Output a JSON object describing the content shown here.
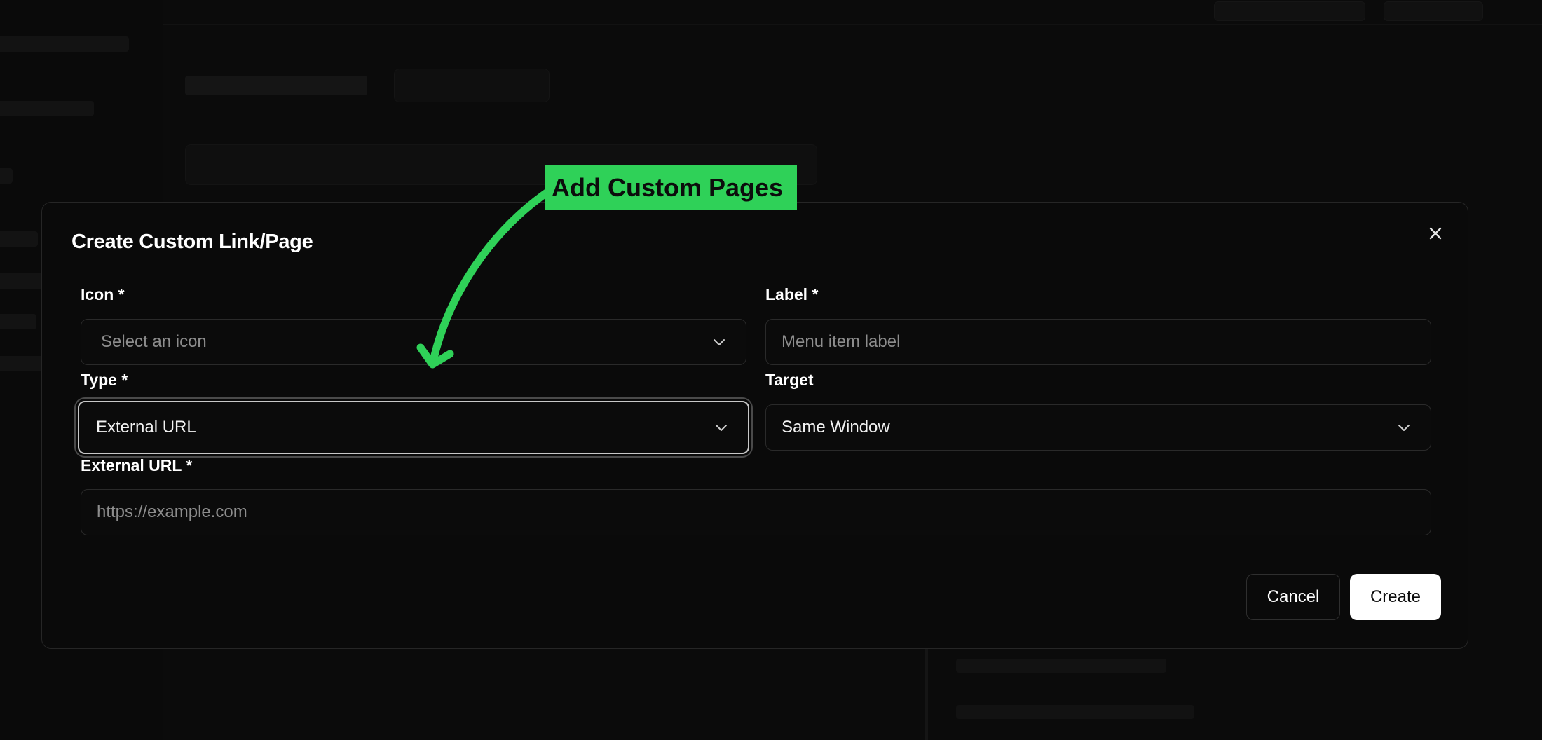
{
  "dialog": {
    "title": "Create Custom Link/Page",
    "fields": {
      "icon": {
        "label": "Icon *",
        "placeholder": "Select an icon"
      },
      "label": {
        "label": "Label *",
        "placeholder": "Menu item label"
      },
      "type": {
        "label": "Type *",
        "value": "External URL"
      },
      "target": {
        "label": "Target",
        "value": "Same Window"
      },
      "external_url": {
        "label": "External URL *",
        "placeholder": "https://example.com"
      }
    },
    "buttons": {
      "cancel": "Cancel",
      "create": "Create"
    }
  },
  "annotation": {
    "text": "Add Custom Pages",
    "color": "#2fd158"
  },
  "icons": [
    "close-icon",
    "chevron-down-icon"
  ]
}
